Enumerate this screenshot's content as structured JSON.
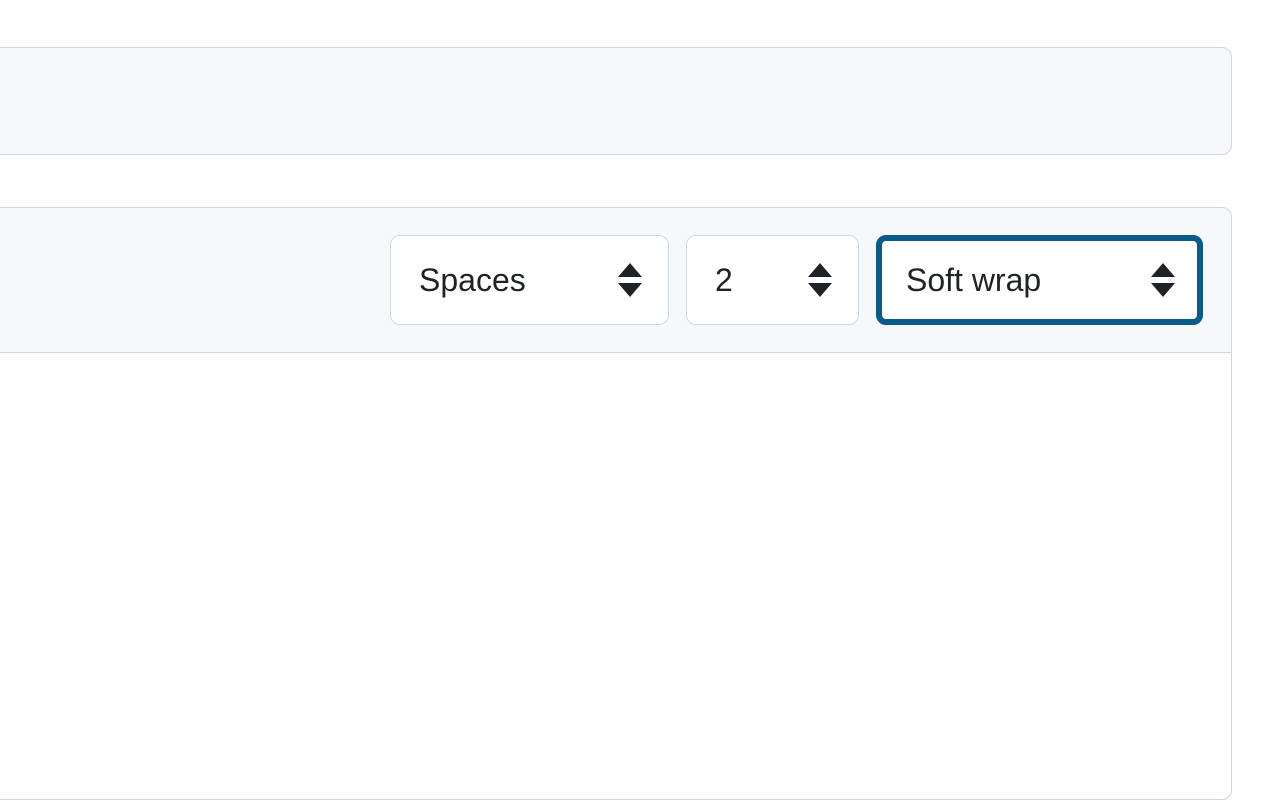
{
  "toolbar": {
    "indent_mode": "Spaces",
    "indent_size": "2",
    "wrap_mode": "Soft wrap"
  }
}
